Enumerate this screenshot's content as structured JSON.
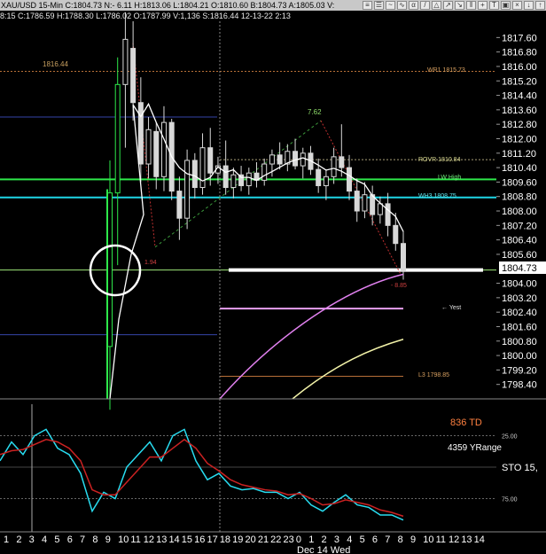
{
  "topbar": {
    "ticker": "XAU/USD 15-Min C:1804.73 N:- 6.11 H:1813.06 L:1804.21 O:1810.60 B:1804.73 A:1805.03 V:",
    "icons": [
      "lines-icon",
      "menu-icon",
      "wave-icon",
      "sine-icon",
      "alpha-icon",
      "line-icon",
      "triangle-icon",
      "trend-up-icon",
      "trend-down-icon",
      "bar-icon",
      "crosshair-icon",
      "text-icon",
      "lock-icon",
      "close-icon",
      "down-arrow-icon",
      "up-arrow-icon"
    ]
  },
  "statbar": {
    "text": "8:15 C:1786.59 H:1788.30 L:1786.02 O:1787.99 V:1,136 S:1816.44 12-13-22 2:13"
  },
  "annotations": {
    "r1": "WR1 1815.73",
    "rover": "ROVR 1810.84",
    "lw_high": "LW High",
    "wh3": "WH3 1808.75",
    "yest": "← Yest",
    "l3": "L3 1798.85",
    "left_high": "1816.44",
    "swing": "7.62",
    "low_label": "1.94",
    "neg_label": "- 8.85",
    "current": "1804.73",
    "td": "836 TD",
    "yrange": "4359 YRange",
    "sto": "STO 15,"
  },
  "colors": {
    "bg": "#000000",
    "candles": "#d8d8d8",
    "green": "#2ee84a",
    "cyan": "#1ed6e6",
    "magenta": "#e080ee",
    "yellow": "#f2f2a8",
    "orange_dash": "#b87038",
    "blue": "#3444a8",
    "stoch_cyan": "#28dcf0",
    "stoch_red": "#cc2222",
    "td_orange": "#ff8040"
  },
  "chart_data": [
    {
      "type": "candlestick",
      "title": "XAU/USD 15-Min",
      "y_ticks": [
        1817.6,
        1816.8,
        1816.0,
        1815.2,
        1814.4,
        1813.6,
        1812.8,
        1812.0,
        1811.2,
        1810.4,
        1809.6,
        1808.8,
        1808.0,
        1807.2,
        1806.4,
        1805.6,
        1804.0,
        1803.2,
        1802.4,
        1801.6,
        1800.8,
        1800.0,
        1799.2,
        1798.4
      ],
      "ylim": [
        1797.6,
        1818.5
      ],
      "current_price": 1804.73,
      "levels": [
        {
          "label": "WR1",
          "value": 1815.73
        },
        {
          "label": "ROVR",
          "value": 1810.84
        },
        {
          "label": "WH3",
          "value": 1808.75
        },
        {
          "label": "L3",
          "value": 1798.85
        }
      ],
      "candles": [
        {
          "o": 1800.5,
          "h": 1810.8,
          "l": 1797.0,
          "c": 1809.0
        },
        {
          "o": 1809.0,
          "h": 1816.5,
          "l": 1805.0,
          "c": 1815.0
        },
        {
          "o": 1815.0,
          "h": 1819.0,
          "l": 1811.5,
          "c": 1817.5
        },
        {
          "o": 1817.0,
          "h": 1818.5,
          "l": 1813.0,
          "c": 1814.0
        },
        {
          "o": 1814.0,
          "h": 1815.4,
          "l": 1809.6,
          "c": 1810.6
        },
        {
          "o": 1810.6,
          "h": 1813.2,
          "l": 1809.8,
          "c": 1812.5
        },
        {
          "o": 1812.4,
          "h": 1812.9,
          "l": 1809.2,
          "c": 1809.9
        },
        {
          "o": 1809.9,
          "h": 1813.8,
          "l": 1809.1,
          "c": 1812.9
        },
        {
          "o": 1812.9,
          "h": 1813.1,
          "l": 1808.6,
          "c": 1809.1
        },
        {
          "o": 1809.1,
          "h": 1809.9,
          "l": 1806.4,
          "c": 1807.6
        },
        {
          "o": 1807.6,
          "h": 1811.4,
          "l": 1807.0,
          "c": 1810.8
        },
        {
          "o": 1810.8,
          "h": 1811.2,
          "l": 1808.7,
          "c": 1809.3
        },
        {
          "o": 1809.3,
          "h": 1812.3,
          "l": 1808.9,
          "c": 1811.5
        },
        {
          "o": 1811.5,
          "h": 1812.6,
          "l": 1809.4,
          "c": 1810.1
        },
        {
          "o": 1810.1,
          "h": 1811.0,
          "l": 1809.5,
          "c": 1810.5
        },
        {
          "o": 1810.5,
          "h": 1811.9,
          "l": 1808.9,
          "c": 1809.3
        },
        {
          "o": 1809.3,
          "h": 1810.4,
          "l": 1808.7,
          "c": 1810.0
        },
        {
          "o": 1810.0,
          "h": 1810.5,
          "l": 1809.1,
          "c": 1809.4
        },
        {
          "o": 1809.4,
          "h": 1810.4,
          "l": 1808.9,
          "c": 1810.1
        },
        {
          "o": 1810.1,
          "h": 1810.7,
          "l": 1809.3,
          "c": 1809.7
        },
        {
          "o": 1809.7,
          "h": 1810.9,
          "l": 1809.4,
          "c": 1810.6
        },
        {
          "o": 1810.6,
          "h": 1811.4,
          "l": 1809.9,
          "c": 1811.1
        },
        {
          "o": 1811.1,
          "h": 1811.8,
          "l": 1810.3,
          "c": 1810.6
        },
        {
          "o": 1810.6,
          "h": 1811.7,
          "l": 1810.2,
          "c": 1811.3
        },
        {
          "o": 1811.3,
          "h": 1812.0,
          "l": 1810.3,
          "c": 1810.5
        },
        {
          "o": 1810.5,
          "h": 1811.5,
          "l": 1809.8,
          "c": 1811.2
        },
        {
          "o": 1811.2,
          "h": 1811.6,
          "l": 1810.0,
          "c": 1810.3
        },
        {
          "o": 1810.3,
          "h": 1810.9,
          "l": 1809.0,
          "c": 1809.4
        },
        {
          "o": 1809.4,
          "h": 1810.3,
          "l": 1808.6,
          "c": 1809.9
        },
        {
          "o": 1809.9,
          "h": 1811.5,
          "l": 1809.5,
          "c": 1811.0
        },
        {
          "o": 1811.0,
          "h": 1812.8,
          "l": 1809.9,
          "c": 1810.4
        },
        {
          "o": 1810.4,
          "h": 1811.1,
          "l": 1808.6,
          "c": 1809.1
        },
        {
          "o": 1809.1,
          "h": 1809.8,
          "l": 1807.4,
          "c": 1808.0
        },
        {
          "o": 1808.0,
          "h": 1809.6,
          "l": 1807.6,
          "c": 1808.9
        },
        {
          "o": 1808.9,
          "h": 1809.4,
          "l": 1807.2,
          "c": 1807.8
        },
        {
          "o": 1807.8,
          "h": 1808.8,
          "l": 1807.3,
          "c": 1808.4
        },
        {
          "o": 1808.4,
          "h": 1809.0,
          "l": 1806.6,
          "c": 1807.2
        },
        {
          "o": 1807.2,
          "h": 1807.9,
          "l": 1805.8,
          "c": 1806.2
        },
        {
          "o": 1806.2,
          "h": 1806.9,
          "l": 1804.2,
          "c": 1804.7
        }
      ],
      "x_ticks": [
        "1",
        "2",
        "3",
        "4",
        "5",
        "6",
        "7",
        "8",
        "9",
        "10",
        "11",
        "12",
        "13",
        "14",
        "15",
        "16",
        "17",
        "18",
        "19",
        "20",
        "21",
        "22",
        "23",
        "0",
        "1",
        "2",
        "3",
        "4",
        "5",
        "6",
        "7",
        "8",
        "9",
        "10",
        "11",
        "12",
        "13",
        "14"
      ],
      "x_date_label": "Dec 14 Wed"
    },
    {
      "type": "line",
      "title": "STO 15,",
      "y_ticks": [
        25.0,
        75.0
      ],
      "ylim": [
        0,
        100
      ],
      "series": [
        {
          "values": [
            45,
            30,
            40,
            25,
            20,
            35,
            40,
            55,
            85,
            70,
            75,
            50,
            40,
            30,
            45,
            25,
            20,
            45,
            60,
            55,
            65,
            68,
            67,
            70,
            70,
            75,
            70,
            80,
            85,
            78,
            72,
            80,
            82,
            88,
            88,
            92
          ]
        },
        {
          "values": [
            40,
            37,
            36,
            32,
            28,
            30,
            35,
            45,
            68,
            72,
            72,
            62,
            52,
            42,
            42,
            35,
            28,
            35,
            47,
            53,
            60,
            64,
            66,
            68,
            69,
            72,
            71,
            75,
            80,
            79,
            76,
            78,
            80,
            84,
            86,
            89
          ]
        }
      ]
    }
  ]
}
